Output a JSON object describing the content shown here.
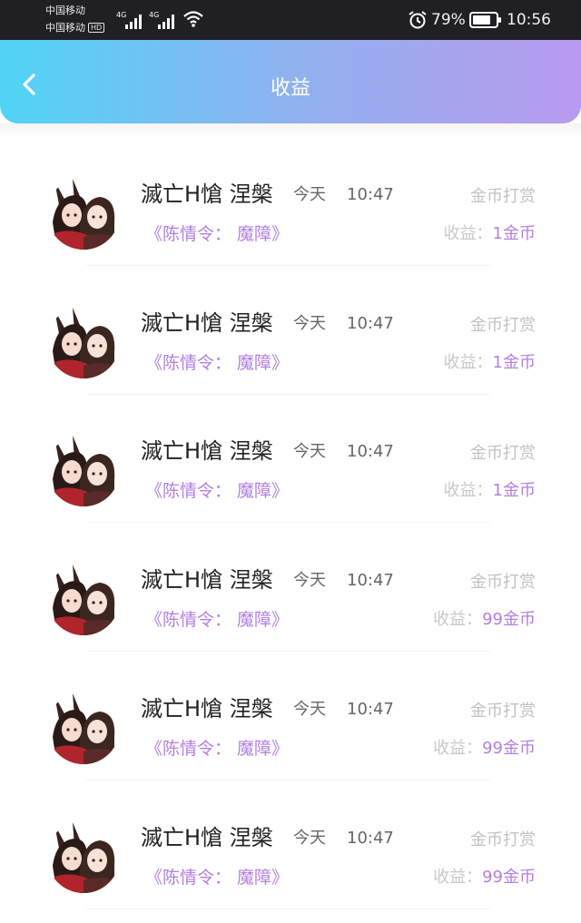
{
  "status_bar": {
    "carrier_1": "中国移动",
    "carrier_2": "中国移动",
    "hd_badge": "HD",
    "signal_1_label": "4G",
    "signal_2_label": "4G",
    "battery_percent": "79%",
    "battery_level": 0.79,
    "time": "10:56",
    "icons": [
      "signal-icon",
      "wifi-icon",
      "alarm-icon",
      "battery-icon"
    ]
  },
  "header": {
    "title": "收益",
    "back_icon": "chevron-left-icon",
    "gradient": [
      "#4fd4f5",
      "#8fb2ef",
      "#b99aee"
    ]
  },
  "colors": {
    "accent": "#b27fe0",
    "muted": "#c2c2c2",
    "name": "#222222"
  },
  "records": [
    {
      "name": "滅亡H愴 涅槃",
      "day": "今天",
      "time": "10:47",
      "type": "金币打赏",
      "work": "《陈情令： 魔障》",
      "income_label": "收益：",
      "income_value": "1金币"
    },
    {
      "name": "滅亡H愴 涅槃",
      "day": "今天",
      "time": "10:47",
      "type": "金币打赏",
      "work": "《陈情令： 魔障》",
      "income_label": "收益：",
      "income_value": "1金币"
    },
    {
      "name": "滅亡H愴 涅槃",
      "day": "今天",
      "time": "10:47",
      "type": "金币打赏",
      "work": "《陈情令： 魔障》",
      "income_label": "收益：",
      "income_value": "1金币"
    },
    {
      "name": "滅亡H愴 涅槃",
      "day": "今天",
      "time": "10:47",
      "type": "金币打赏",
      "work": "《陈情令： 魔障》",
      "income_label": "收益：",
      "income_value": "99金币"
    },
    {
      "name": "滅亡H愴 涅槃",
      "day": "今天",
      "time": "10:47",
      "type": "金币打赏",
      "work": "《陈情令： 魔障》",
      "income_label": "收益：",
      "income_value": "99金币"
    },
    {
      "name": "滅亡H愴 涅槃",
      "day": "今天",
      "time": "10:47",
      "type": "金币打赏",
      "work": "《陈情令： 魔障》",
      "income_label": "收益：",
      "income_value": "99金币"
    }
  ]
}
